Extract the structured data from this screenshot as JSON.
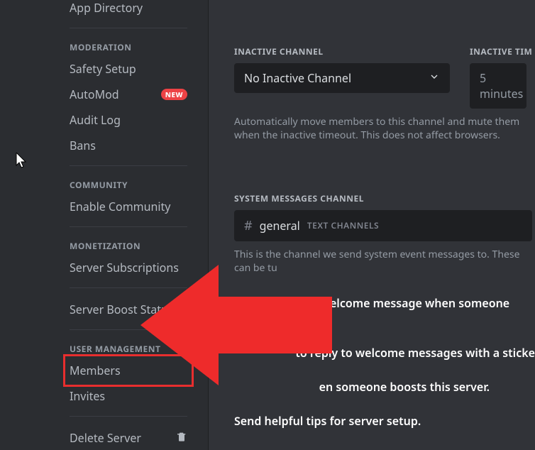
{
  "sidebar": {
    "topItem": "App Directory",
    "sections": [
      {
        "header": "MODERATION",
        "items": [
          {
            "label": "Safety Setup",
            "badge": null
          },
          {
            "label": "AutoMod",
            "badge": "NEW"
          },
          {
            "label": "Audit Log",
            "badge": null
          },
          {
            "label": "Bans",
            "badge": null
          }
        ]
      },
      {
        "header": "COMMUNITY",
        "items": [
          {
            "label": "Enable Community",
            "badge": null
          }
        ]
      },
      {
        "header": "MONETIZATION",
        "items": [
          {
            "label": "Server Subscriptions",
            "badge": null
          }
        ]
      }
    ],
    "boostItem": "Server Boost Status",
    "userManagement": {
      "header": "USER MANAGEMENT",
      "items": [
        {
          "label": "Members",
          "highlighted": true
        },
        {
          "label": "Invites",
          "highlighted": false
        }
      ]
    },
    "deleteItem": "Delete Server"
  },
  "content": {
    "inactive": {
      "channelLabel": "INACTIVE CHANNEL",
      "channelValue": "No Inactive Channel",
      "timeoutLabel": "INACTIVE TIM",
      "timeoutValue": "5 minutes",
      "helper": "Automatically move members to this channel and mute them when the inactive timeout. This does not affect browsers."
    },
    "systemMessages": {
      "label": "SYSTEM MESSAGES CHANNEL",
      "channelName": "general",
      "channelCategory": "TEXT CHANNELS",
      "helper": "This is the channel we send system event messages to. These can be tu"
    },
    "toggles": [
      "Send a random welcome message when someone joins this se",
      "to reply to welcome messages with a sticke",
      "en someone boosts this server.",
      "Send helpful tips for server setup."
    ]
  }
}
